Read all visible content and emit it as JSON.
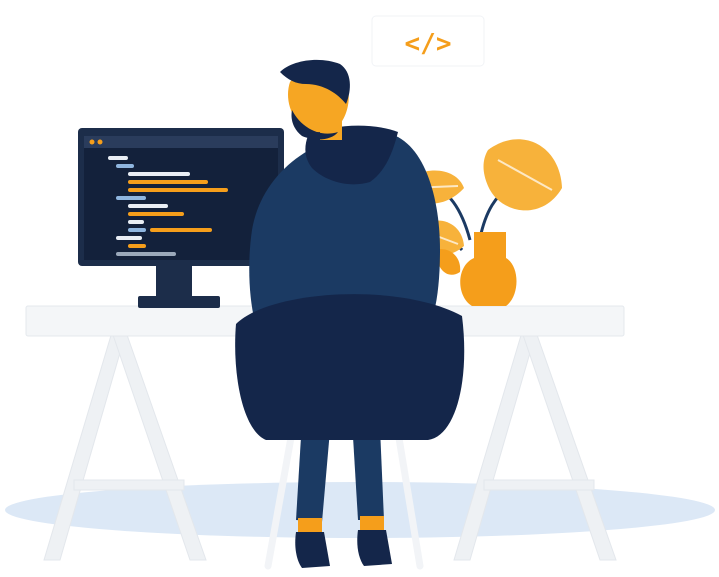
{
  "illustration": {
    "badge_text": "</>",
    "colors": {
      "navy": "#1b3a63",
      "navy_dark": "#14264a",
      "orange": "#f59e1b",
      "orange_light": "#f7b23b",
      "skin": "#f6a623",
      "desk": "#f4f6f8",
      "desk_legs": "#eef1f4",
      "shadow": "#dce8f6",
      "monitor": "#1c2d4a",
      "screen": "#13213b",
      "code_white": "#e9eef5",
      "code_blue": "#8fb6e0",
      "code_orange": "#f59e1b",
      "code_gray": "#9aa8ba"
    }
  }
}
